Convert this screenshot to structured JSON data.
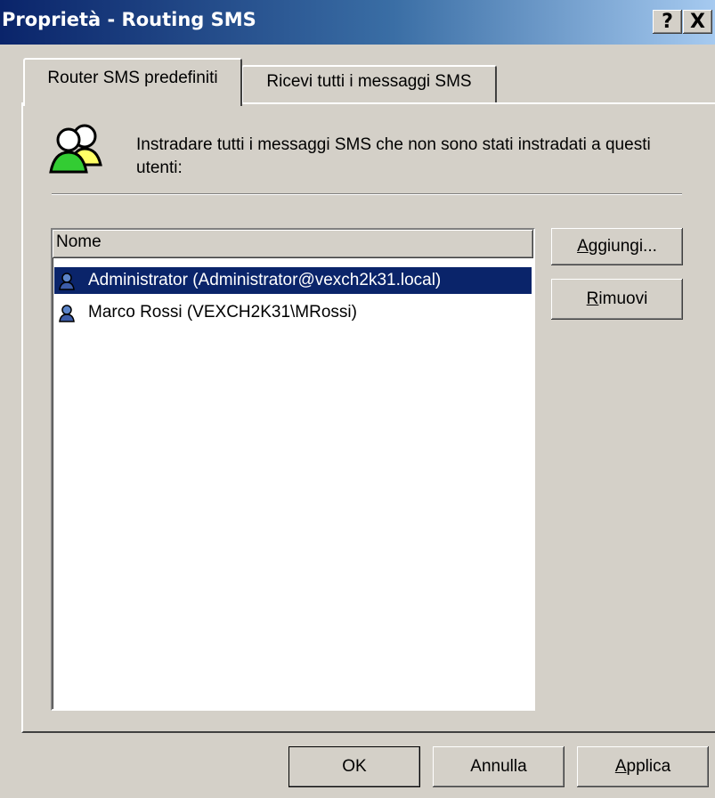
{
  "window": {
    "title": "Proprietà - Routing SMS",
    "help_label": "?",
    "close_label": "X"
  },
  "tabs": [
    {
      "label": "Router SMS predefiniti",
      "active": true
    },
    {
      "label": "Ricevi tutti i messaggi SMS",
      "active": false
    }
  ],
  "panel": {
    "icon": "users-icon",
    "description": "Instradare tutti i messaggi SMS che non sono stati instradati a questi utenti:"
  },
  "list": {
    "column_header": "Nome",
    "rows": [
      {
        "text": "Administrator (Administrator@vexch2k31.local)",
        "icon": "user-icon",
        "selected": true
      },
      {
        "text": "Marco Rossi (VEXCH2K31\\MRossi)",
        "icon": "user-icon",
        "selected": false
      }
    ]
  },
  "side_buttons": {
    "add": {
      "mnemonic": "A",
      "rest": "ggiungi..."
    },
    "remove": {
      "mnemonic": "R",
      "rest": "imuovi"
    }
  },
  "footer": {
    "ok": "OK",
    "cancel": "Annulla",
    "apply": {
      "mnemonic": "A",
      "rest": "pplica"
    }
  },
  "colors": {
    "selection": "#0a246a",
    "face": "#d4d0c8",
    "title_start": "#0a246a",
    "title_end": "#a6caf0"
  }
}
